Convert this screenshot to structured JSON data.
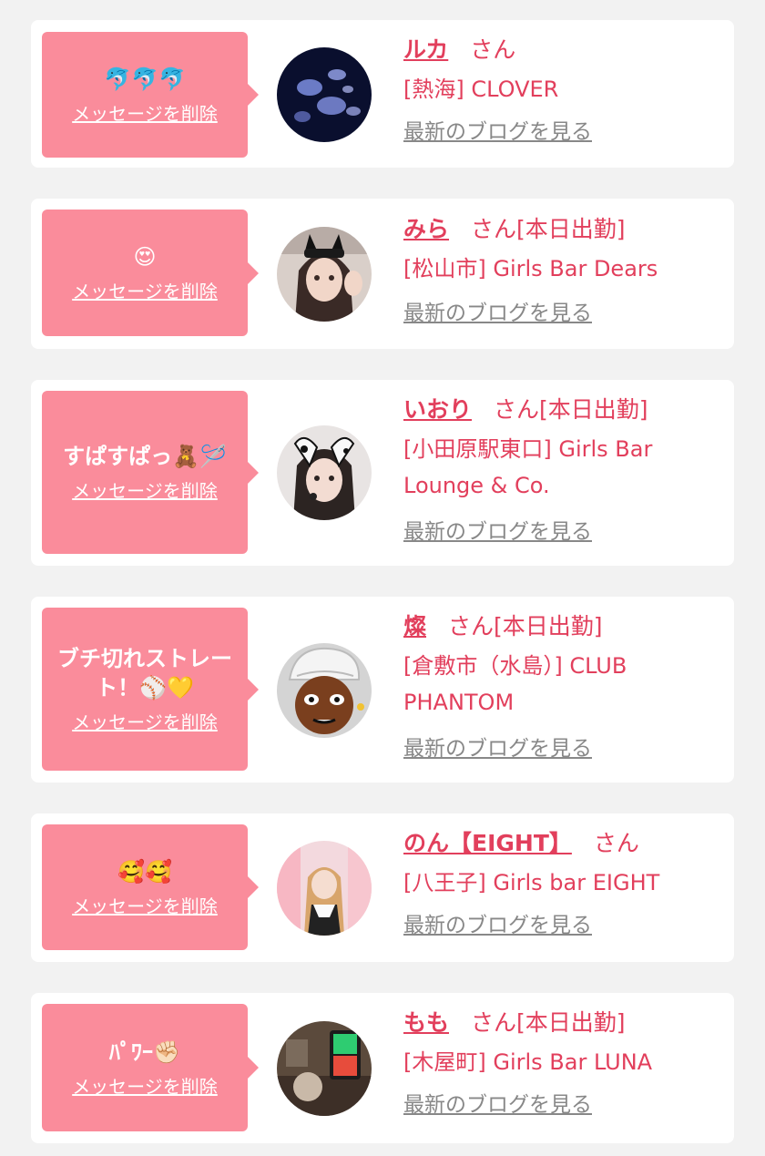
{
  "items": [
    {
      "message": "🐬🐬🐬",
      "delete_label": "メッセージを削除",
      "name": "ルカ",
      "suffix": "さん",
      "status": "",
      "shop": "[熱海] CLOVER",
      "blog_label": "最新のブログを見る",
      "avatar_desc": "jellyfish"
    },
    {
      "message": "😍",
      "delete_label": "メッセージを削除",
      "name": "みら",
      "suffix": "さん",
      "status": "[本日出勤]",
      "shop": "[松山市] Girls Bar Dears",
      "blog_label": "最新のブログを見る",
      "avatar_desc": "girl-cat-ears"
    },
    {
      "message": "すぱすぱっ🧸🪡",
      "delete_label": "メッセージを削除",
      "name": "いおり",
      "suffix": "さん",
      "status": "[本日出勤]",
      "shop": "[小田原駅東口] Girls Bar Lounge & Co.",
      "blog_label": "最新のブログを見る",
      "avatar_desc": "girl-dog-ears"
    },
    {
      "message": "ブチ切れストレート！⚾💛",
      "delete_label": "メッセージを削除",
      "name": "燦",
      "suffix": "さん",
      "status": "[本日出勤]",
      "shop": "[倉敷市（水島）] CLUB PHANTOM",
      "blog_label": "最新のブログを見る",
      "avatar_desc": "cartoon-face"
    },
    {
      "message": "🥰🥰",
      "delete_label": "メッセージを削除",
      "name": "のん【EIGHT】",
      "suffix": "さん",
      "status": "",
      "shop": "[八王子] Girls bar EIGHT",
      "blog_label": "最新のブログを見る",
      "avatar_desc": "girl-pink-room"
    },
    {
      "message": "ﾊﾟﾜｰ✊🏻",
      "delete_label": "メッセージを削除",
      "name": "もも",
      "suffix": "さん",
      "status": "[本日出勤]",
      "shop": "[木屋町] Girls Bar LUNA",
      "blog_label": "最新のブログを見る",
      "avatar_desc": "street-signal"
    }
  ],
  "colors": {
    "accent": "#e23f5c",
    "bubble": "#fa8c9b",
    "background": "#f2f2f2"
  }
}
